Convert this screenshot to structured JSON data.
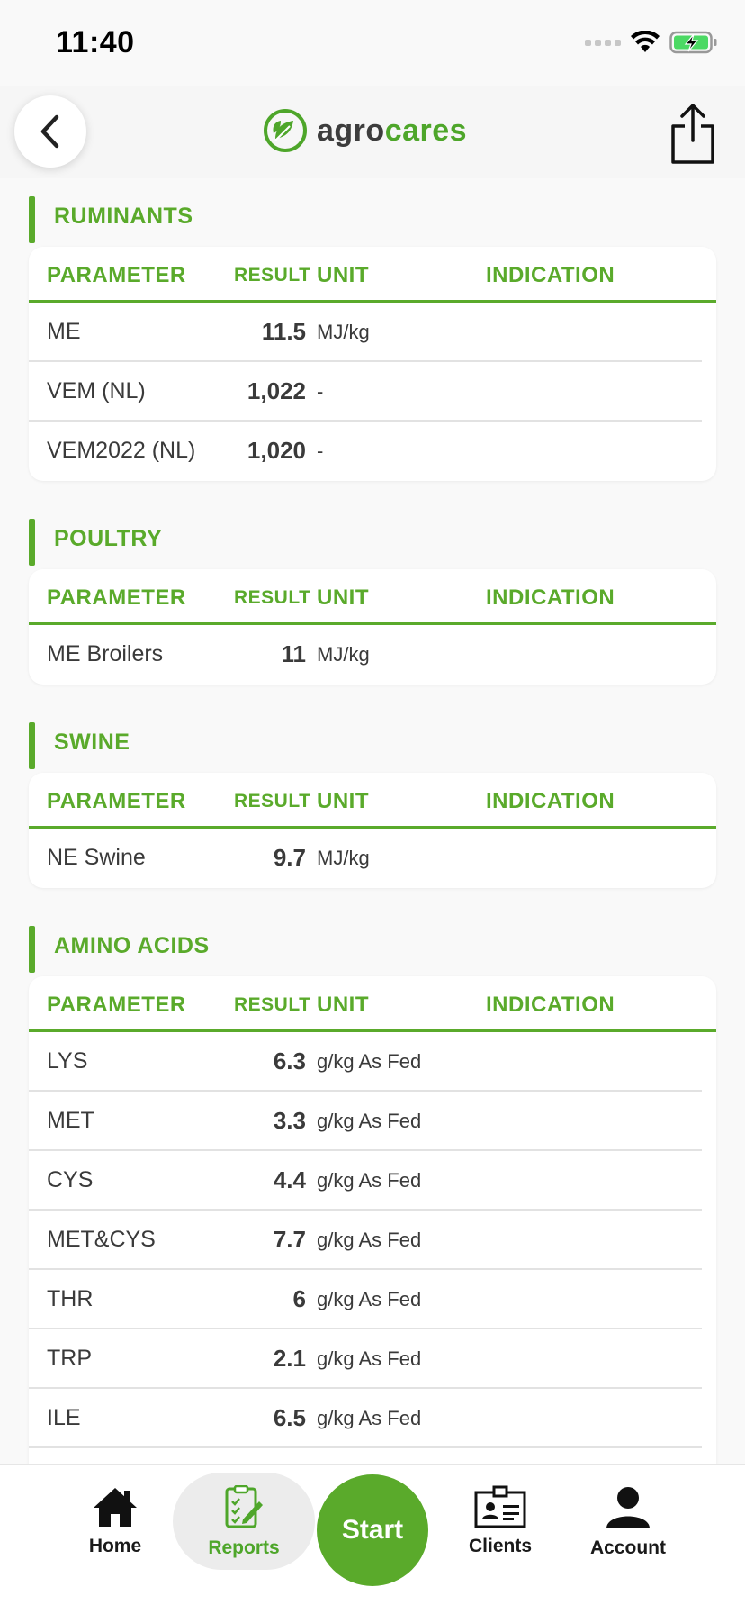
{
  "status": {
    "time": "11:40"
  },
  "header": {
    "logo_agro": "agro",
    "logo_cares": "cares"
  },
  "columns": {
    "parameter": "PARAMETER",
    "result": "RESULT",
    "unit": "UNIT",
    "indication": "INDICATION"
  },
  "sections": [
    {
      "title": "RUMINANTS",
      "rows": [
        {
          "parameter": "ME",
          "result": "11.5",
          "unit": "MJ/kg"
        },
        {
          "parameter": "VEM (NL)",
          "result": "1,022",
          "unit": "-"
        },
        {
          "parameter": "VEM2022 (NL)",
          "result": "1,020",
          "unit": "-"
        }
      ]
    },
    {
      "title": "POULTRY",
      "rows": [
        {
          "parameter": "ME Broilers",
          "result": "11",
          "unit": "MJ/kg"
        }
      ]
    },
    {
      "title": "SWINE",
      "rows": [
        {
          "parameter": "NE Swine",
          "result": "9.7",
          "unit": "MJ/kg"
        }
      ]
    },
    {
      "title": "AMINO ACIDS",
      "rows": [
        {
          "parameter": "LYS",
          "result": "6.3",
          "unit": "g/kg As Fed"
        },
        {
          "parameter": "MET",
          "result": "3.3",
          "unit": "g/kg As Fed"
        },
        {
          "parameter": "CYS",
          "result": "4.4",
          "unit": "g/kg As Fed"
        },
        {
          "parameter": "MET&CYS",
          "result": "7.7",
          "unit": "g/kg As Fed"
        },
        {
          "parameter": "THR",
          "result": "6",
          "unit": "g/kg As Fed"
        },
        {
          "parameter": "TRP",
          "result": "2.1",
          "unit": "g/kg As Fed"
        },
        {
          "parameter": "ILE",
          "result": "6.5",
          "unit": "g/kg As Fed"
        },
        {
          "parameter": "",
          "result": "",
          "unit": ""
        }
      ]
    }
  ],
  "tabbar": {
    "home": "Home",
    "reports": "Reports",
    "start": "Start",
    "clients": "Clients",
    "account": "Account"
  },
  "colors": {
    "brand_green": "#5aaa2b",
    "logo_green": "#4ea62a"
  }
}
